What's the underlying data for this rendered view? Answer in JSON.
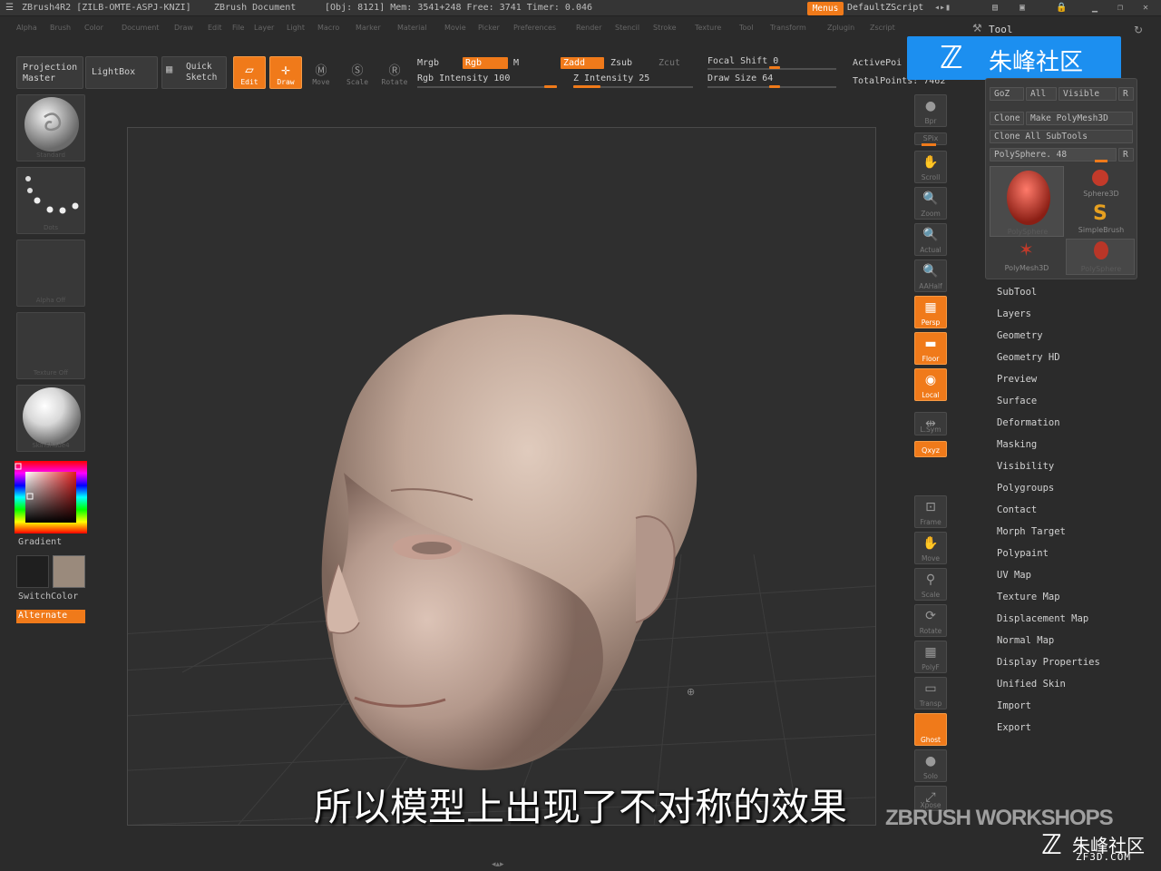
{
  "titlebar": {
    "app": "ZBrush4R2 [ZILB-OMTE-ASPJ-KNZI]",
    "document": "ZBrush Document",
    "stats": "[Obj: 8121] Mem: 3541+248  Free: 3741  Timer: 0.046",
    "menus_label": "Menus",
    "script_label": "DefaultZScript"
  },
  "menubar": [
    "Alpha",
    "Brush",
    "Color",
    "Document",
    "Draw",
    "Edit",
    "File",
    "Layer",
    "Light",
    "Macro",
    "Marker",
    "Material",
    "Movie",
    "Picker",
    "Preferences",
    "Render",
    "Stencil",
    "Stroke",
    "Texture",
    "Tool",
    "Transform",
    "Zplugin",
    "Zscript"
  ],
  "toolbar": {
    "projection_master": "Projection Master",
    "lightbox": "LightBox",
    "quick_sketch": "Quick Sketch",
    "edit": "Edit",
    "draw": "Draw",
    "move": "Move",
    "scale": "Scale",
    "rotate": "Rotate",
    "mrgb": "Mrgb",
    "rgb": "Rgb",
    "m": "M",
    "rgb_intensity": "Rgb Intensity 100",
    "zadd": "Zadd",
    "zsub": "Zsub",
    "zcut": "Zcut",
    "z_intensity": "Z Intensity 25",
    "focal_shift": "Focal Shift 0",
    "draw_size": "Draw Size 64",
    "active_points": "ActivePoi",
    "total_points": "TotalPoints: 7462"
  },
  "left_shelf": {
    "brush_caption": "Standard",
    "stroke_caption": "Dots",
    "alpha_caption": "Alpha Off",
    "texture_caption": "Texture Off",
    "material_caption": "SkinShade4",
    "gradient": "Gradient",
    "switchcolor": "SwitchColor",
    "alternate": "Alternate"
  },
  "dock": [
    "Bpr",
    "SPix",
    "Scroll",
    "Zoom",
    "Actual",
    "AAHalf",
    "Persp",
    "Floor",
    "Local",
    "L.Sym",
    "Qxyz",
    "Frame",
    "Move",
    "Scale",
    "Rotate",
    "PolyF",
    "Transp",
    "Ghost",
    "Solo",
    "Xpose"
  ],
  "tool_panel": {
    "title": "Tool",
    "goz": "GoZ",
    "all": "All",
    "visible": "Visible",
    "r": "R",
    "clone": "Clone",
    "make_polymesh": "Make PolyMesh3D",
    "clone_all": "Clone All SubTools",
    "current_tool": "PolySphere. 48",
    "thumbs": [
      "PolySphere",
      "Sphere3D",
      "SimpleBrush",
      "PolyMesh3D",
      "PolySphere"
    ]
  },
  "submenus": [
    "SubTool",
    "Layers",
    "Geometry",
    "Geometry HD",
    "Preview",
    "Surface",
    "Deformation",
    "Masking",
    "Visibility",
    "Polygroups",
    "Contact",
    "Morph Target",
    "Polypaint",
    "UV Map",
    "Texture Map",
    "Displacement Map",
    "Normal Map",
    "Display Properties",
    "Unified Skin",
    "Import",
    "Export"
  ],
  "subtitle": "所以模型上出现了不对称的效果",
  "watermark": {
    "banner": "朱峰社区",
    "workshops": "ZBRUSH WORKSHOPS",
    "bottom": "朱峰社区",
    "url": "ZF3D.COM"
  },
  "colors": {
    "accent": "#f07a1a",
    "bg": "#2b2b2b",
    "canvas": "#2f2f2f",
    "banner": "#1c8ff0"
  }
}
